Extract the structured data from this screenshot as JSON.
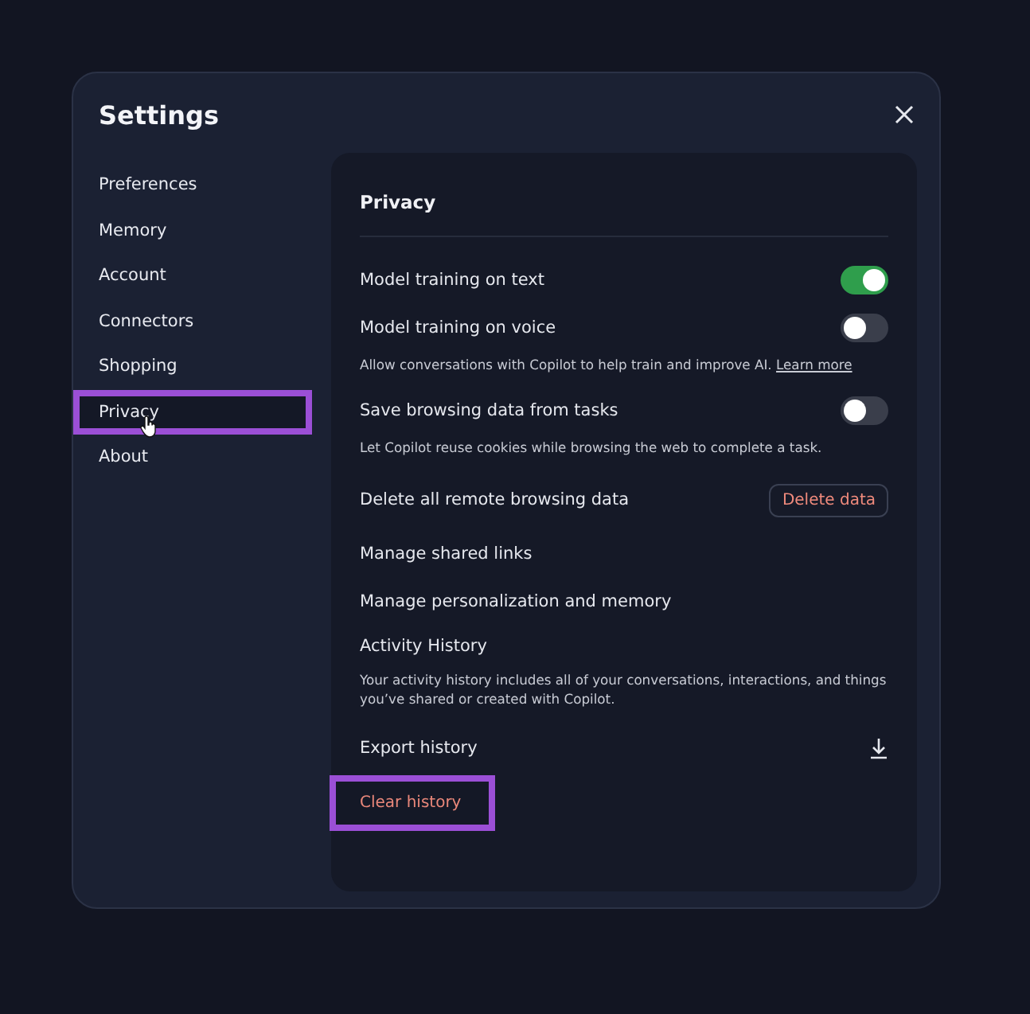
{
  "dialog": {
    "title": "Settings"
  },
  "sidebar": {
    "items": [
      {
        "label": "Preferences",
        "selected": false,
        "highlighted": false
      },
      {
        "label": "Memory",
        "selected": false,
        "highlighted": false
      },
      {
        "label": "Account",
        "selected": false,
        "highlighted": false
      },
      {
        "label": "Connectors",
        "selected": false,
        "highlighted": false
      },
      {
        "label": "Shopping",
        "selected": false,
        "highlighted": false
      },
      {
        "label": "Privacy",
        "selected": true,
        "highlighted": true
      },
      {
        "label": "About",
        "selected": false,
        "highlighted": false
      }
    ]
  },
  "panel": {
    "title": "Privacy",
    "rows": [
      {
        "kind": "toggle",
        "label": "Model training on text",
        "on": true
      },
      {
        "kind": "toggle",
        "label": "Model training on voice",
        "on": false
      },
      {
        "kind": "note",
        "text": "Allow conversations with Copilot to help train and improve AI.",
        "link": "Learn more"
      },
      {
        "kind": "toggle",
        "label": "Save browsing data from tasks",
        "on": false
      },
      {
        "kind": "note",
        "text": "Let Copilot reuse cookies while browsing the web to complete a task."
      },
      {
        "kind": "action",
        "label": "Delete all remote browsing data",
        "button": "Delete data"
      },
      {
        "kind": "link",
        "label": "Manage shared links"
      },
      {
        "kind": "link",
        "label": "Manage personalization and memory"
      },
      {
        "kind": "heading",
        "label": "Activity History"
      },
      {
        "kind": "note",
        "text": "Your activity history includes all of your conversations, interactions, and things you’ve shared or created with Copilot."
      },
      {
        "kind": "download",
        "label": "Export history"
      },
      {
        "kind": "danger",
        "label": "Clear history",
        "highlighted": true
      }
    ]
  }
}
